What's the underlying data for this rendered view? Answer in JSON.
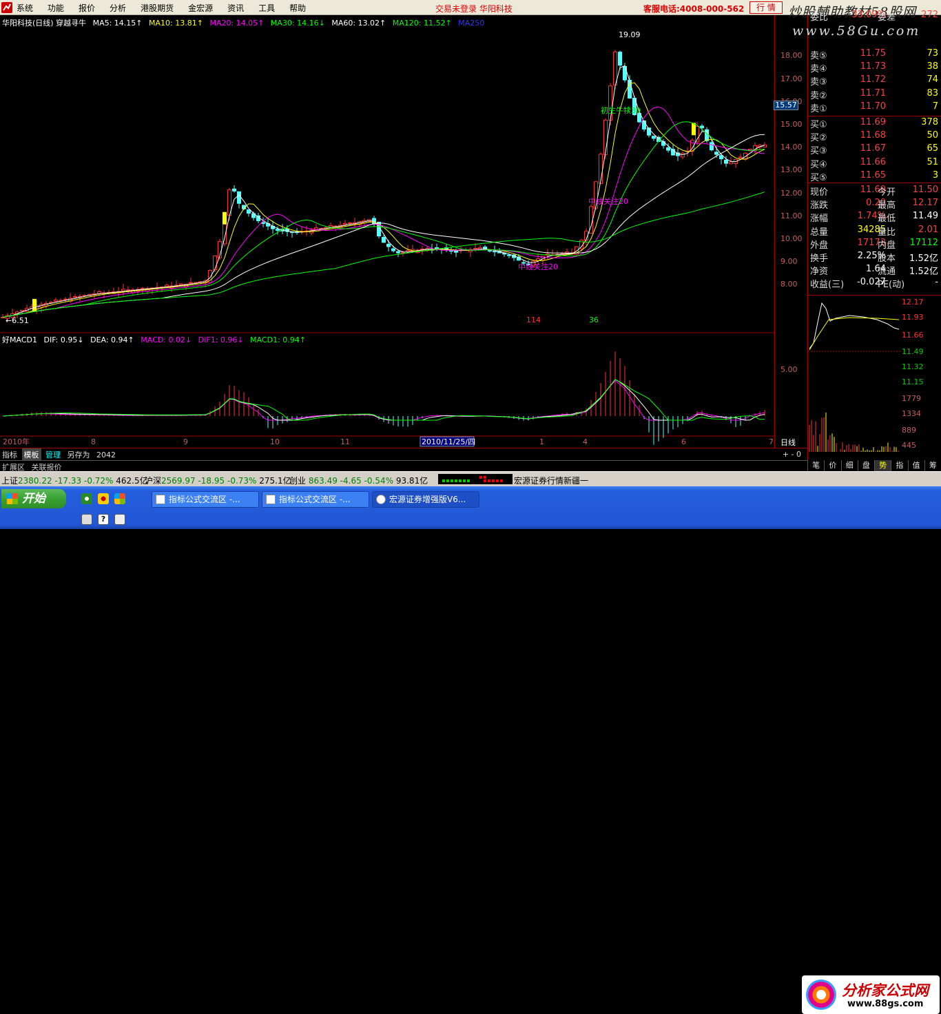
{
  "menubar": {
    "items": [
      "系统",
      "功能",
      "报价",
      "分析",
      "港股期货",
      "金宏源",
      "资讯",
      "工具",
      "帮助"
    ],
    "status": "交易未登录 华阳科技",
    "hotline": "客服电话:4008-000-562",
    "quote_button": "行 情",
    "watermark": "炒股輔助教材58股网",
    "watermark_url": "www.58Gu.com"
  },
  "main_chart": {
    "header": {
      "title": "华阳科技(日线) 穿越寻牛",
      "ma": [
        {
          "label": "MA5: 14.15↑",
          "color": "#ffffff"
        },
        {
          "label": "MA10: 13.81↑",
          "color": "#ffff00"
        },
        {
          "label": "MA20: 14.05↑",
          "color": "#ff00ff"
        },
        {
          "label": "MA30: 14.16↓",
          "color": "#00ff00"
        },
        {
          "label": "MA60: 13.02↑",
          "color": "#ffffff"
        },
        {
          "label": "MA120: 11.52↑",
          "color": "#00ff00"
        },
        {
          "label": "MA250",
          "color": "#0000ff"
        }
      ]
    },
    "price_axis": [
      "18.00",
      "17.00",
      "16.00",
      "15.00",
      "14.00",
      "13.00",
      "12.00",
      "11.00",
      "10.00",
      "9.00",
      "8.00"
    ],
    "current_price": "15.57",
    "annotations": {
      "high": "19.09",
      "low": "←6.51",
      "signal1": "初生牛犊30",
      "signal2": "中线关注20",
      "signal3": "中线关注20",
      "count1": "114",
      "count2": "36"
    }
  },
  "macd": {
    "header": [
      {
        "label": "好MACD1",
        "color": "#ffffff"
      },
      {
        "label": "DIF: 0.95↓",
        "color": "#ffffff"
      },
      {
        "label": "DEA: 0.94↑",
        "color": "#ffffff"
      },
      {
        "label": "MACD: 0.02↓",
        "color": "#ff00ff"
      },
      {
        "label": "DIF1: 0.96↓",
        "color": "#ff00ff"
      },
      {
        "label": "MACD1: 0.94↑",
        "color": "#00ff00"
      }
    ],
    "axis": "5.00"
  },
  "time_axis": [
    {
      "label": "2010年"
    },
    {
      "label": "8"
    },
    {
      "label": "9"
    },
    {
      "label": "10"
    },
    {
      "label": "11"
    },
    {
      "label": "2010/11/25/四",
      "highlight": true
    },
    {
      "label": "1"
    },
    {
      "label": "4"
    },
    {
      "label": "6"
    },
    {
      "label": "7"
    }
  ],
  "time_axis_right": "日线",
  "order_book": {
    "header": {
      "label": "委比",
      "value": "33.09%",
      "label2": "委差",
      "value2": "272"
    },
    "asks": [
      {
        "label": "卖⑤",
        "price": "11.75",
        "vol": "73"
      },
      {
        "label": "卖④",
        "price": "11.73",
        "vol": "38"
      },
      {
        "label": "卖③",
        "price": "11.72",
        "vol": "74"
      },
      {
        "label": "卖②",
        "price": "11.71",
        "vol": "83"
      },
      {
        "label": "卖①",
        "price": "11.70",
        "vol": "7"
      }
    ],
    "bids": [
      {
        "label": "买①",
        "price": "11.69",
        "vol": "378"
      },
      {
        "label": "买②",
        "price": "11.68",
        "vol": "50"
      },
      {
        "label": "买③",
        "price": "11.67",
        "vol": "65"
      },
      {
        "label": "买④",
        "price": "11.66",
        "vol": "51"
      },
      {
        "label": "买⑤",
        "price": "11.65",
        "vol": "3"
      }
    ]
  },
  "quote": [
    {
      "l1": "现价",
      "v1": "11.69",
      "c1": "#ff4040",
      "l2": "今开",
      "v2": "11.50",
      "c2": "#ff4040"
    },
    {
      "l1": "涨跌",
      "v1": "0.20",
      "c1": "#ff4040",
      "l2": "最高",
      "v2": "12.17",
      "c2": "#ff4040"
    },
    {
      "l1": "涨幅",
      "v1": "1.74%",
      "c1": "#ff4040",
      "l2": "最低",
      "v2": "11.49",
      "c2": "#ffffff"
    },
    {
      "l1": "总量",
      "v1": "34285",
      "c1": "#ffff00",
      "l2": "量比",
      "v2": "2.01",
      "c2": "#ff4040"
    },
    {
      "l1": "外盘",
      "v1": "17173",
      "c1": "#ff4040",
      "l2": "内盘",
      "v2": "17112",
      "c2": "#00ff00"
    },
    {
      "l1": "换手",
      "v1": "2.25%",
      "c1": "#ffffff",
      "l2": "股本",
      "v2": "1.52亿",
      "c2": "#ffffff"
    },
    {
      "l1": "净资",
      "v1": "1.64",
      "c1": "#ffffff",
      "l2": "流通",
      "v2": "1.52亿",
      "c2": "#ffffff"
    },
    {
      "l1": "收益(三)",
      "v1": "-0.027",
      "c1": "#ffffff",
      "l2": "PE(动)",
      "v2": "-",
      "c2": "#ffffff"
    }
  ],
  "intraday_axis": [
    "12.17",
    "11.93",
    "11.66",
    "11.49",
    "11.32",
    "11.15",
    "1779",
    "1334",
    "889",
    "445"
  ],
  "bottom_tabs": {
    "row1": [
      "指标",
      "模板",
      "管理",
      "另存为",
      "2042"
    ],
    "row1_active": "管理",
    "row2": [
      "扩展区",
      "关联报价"
    ],
    "pm": "+ - 0"
  },
  "right_tabs": [
    "笔",
    "价",
    "细",
    "盘",
    "势",
    "指",
    "值",
    "筹"
  ],
  "right_tab_active": "势",
  "status_bar": {
    "indices": [
      {
        "name": "上证",
        "value": "2380.22",
        "chg": "-17.33",
        "pct": "-0.72%",
        "amt": "462.5亿"
      },
      {
        "name": "沪深",
        "value": "2569.97",
        "chg": "-18.95",
        "pct": "-0.73%",
        "amt": "275.1亿"
      },
      {
        "name": "创业",
        "value": "863.49",
        "chg": "-4.65",
        "pct": "-0.54%",
        "amt": "93.81亿"
      }
    ],
    "message": "宏源证券行情新疆一"
  },
  "taskbar": {
    "start": "开始",
    "tasks": [
      "指标公式交流区 -...",
      "指标公式交流区 -...",
      "宏源证券增强版V6..."
    ],
    "active_task": 2,
    "brand": "分析家公式网",
    "brand_url": "www.88gs.com"
  }
}
